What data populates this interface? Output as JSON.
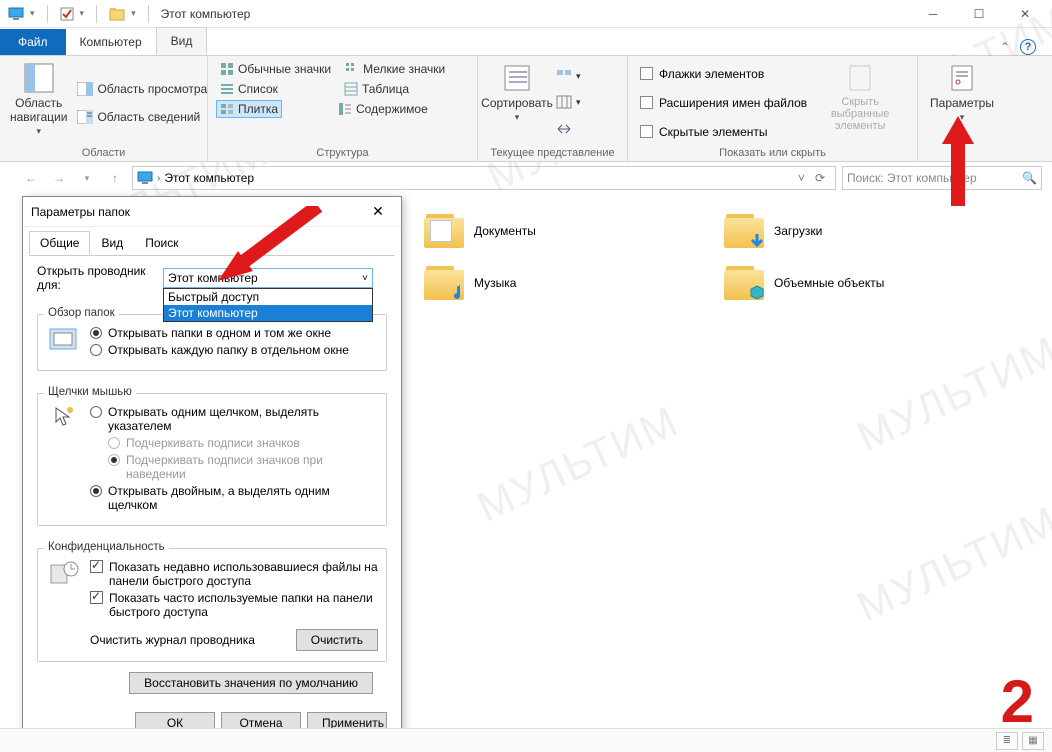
{
  "window": {
    "title": "Этот компьютер"
  },
  "tabs": {
    "file": "Файл",
    "computer": "Компьютер",
    "view": "Вид"
  },
  "ribbon": {
    "panes": {
      "nav": "Область навигации",
      "preview": "Область просмотра",
      "details": "Область сведений"
    },
    "panes_label": "Области",
    "layout": {
      "regular": "Обычные значки",
      "small": "Мелкие значки",
      "list": "Список",
      "table": "Таблица",
      "tiles": "Плитка",
      "content": "Содержимое"
    },
    "layout_label": "Структура",
    "current": {
      "sort": "Сортировать"
    },
    "current_label": "Текущее представление",
    "show": {
      "checkboxes": "Флажки элементов",
      "ext": "Расширения имен файлов",
      "hidden": "Скрытые элементы",
      "hide_sel": "Скрыть выбранные элементы",
      "label": "Показать или скрыть"
    },
    "options": "Параметры"
  },
  "address": {
    "path": "Этот компьютер",
    "search_placeholder": "Поиск: Этот компьютер"
  },
  "folders": {
    "docs": "Документы",
    "downloads": "Загрузки",
    "music": "Музыка",
    "objects3d": "Объемные объекты"
  },
  "dialog": {
    "title": "Параметры папок",
    "tabs": {
      "general": "Общие",
      "view": "Вид",
      "search": "Поиск"
    },
    "open_for_label": "Открыть проводник для:",
    "combo": {
      "selected": "Этот компьютер",
      "opt_quick": "Быстрый доступ",
      "opt_thispc": "Этот компьютер"
    },
    "browse": {
      "title": "Обзор папок",
      "same": "Открывать папки в одном и том же окне",
      "new": "Открывать каждую папку в отдельном окне"
    },
    "click": {
      "title": "Щелчки мышью",
      "single": "Открывать одним щелчком, выделять указателем",
      "underline_always": "Подчеркивать подписи значков",
      "underline_hover": "Подчеркивать подписи значков при наведении",
      "double": "Открывать двойным, а выделять одним щелчком"
    },
    "privacy": {
      "title": "Конфиденциальность",
      "recent": "Показать недавно использовавшиеся файлы на панели быстрого доступа",
      "freq": "Показать часто используемые папки на панели быстрого доступа",
      "clear_label": "Очистить журнал проводника",
      "clear_btn": "Очистить"
    },
    "restore": "Восстановить значения по умолчанию",
    "ok": "ОК",
    "cancel": "Отмена",
    "apply": "Применить"
  },
  "watermark": "МУЛЬТИМ",
  "annotation_number": "2"
}
